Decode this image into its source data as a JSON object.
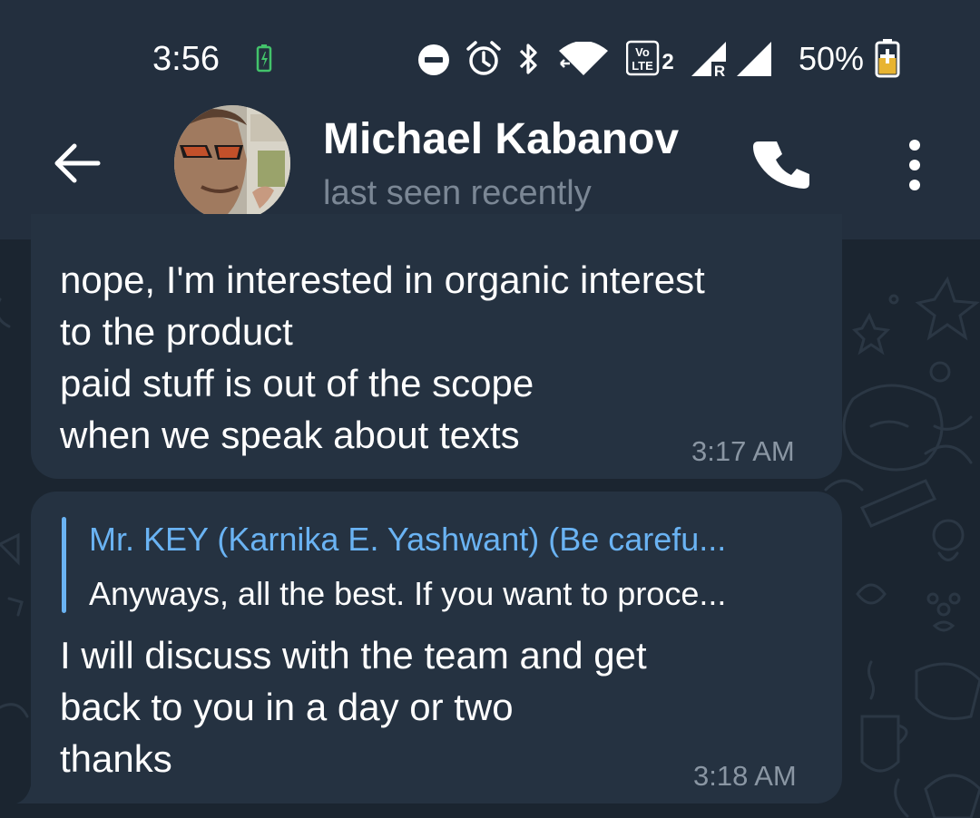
{
  "status_bar": {
    "time": "3:56",
    "battery_percent": "50%",
    "network_badge": "VoLTE2",
    "icons": [
      "battery-charging-icon",
      "dnd-icon",
      "alarm-icon",
      "bluetooth-icon",
      "wifi-icon",
      "volte-icon",
      "signal-icon",
      "signal-roaming-icon",
      "battery-icon"
    ]
  },
  "header": {
    "contact_name": "Michael Kabanov",
    "contact_status": "last seen recently",
    "icons": [
      "back-arrow-icon",
      "phone-icon",
      "more-vertical-icon"
    ]
  },
  "messages": [
    {
      "lines": [
        "nope, I'm interested in organic interest",
        "to the product",
        "paid stuff is out of the scope",
        "when we speak about texts"
      ],
      "time": "3:17 AM"
    },
    {
      "reply_to": {
        "author": "Mr. KEY (Karnika E. Yashwant) (Be carefu...",
        "text": "Anyways, all the best. If you want to proce..."
      },
      "lines": [
        "I will discuss with the team and get",
        "back to you in a day or two",
        "thanks"
      ],
      "time": "3:18 AM"
    }
  ],
  "colors": {
    "header_bg": "#232f3e",
    "chat_bg": "#1b2530",
    "bubble_bg": "#253241",
    "accent": "#6ab3f3",
    "battery_green": "#43c36b",
    "battery_yellow": "#e8b431"
  }
}
